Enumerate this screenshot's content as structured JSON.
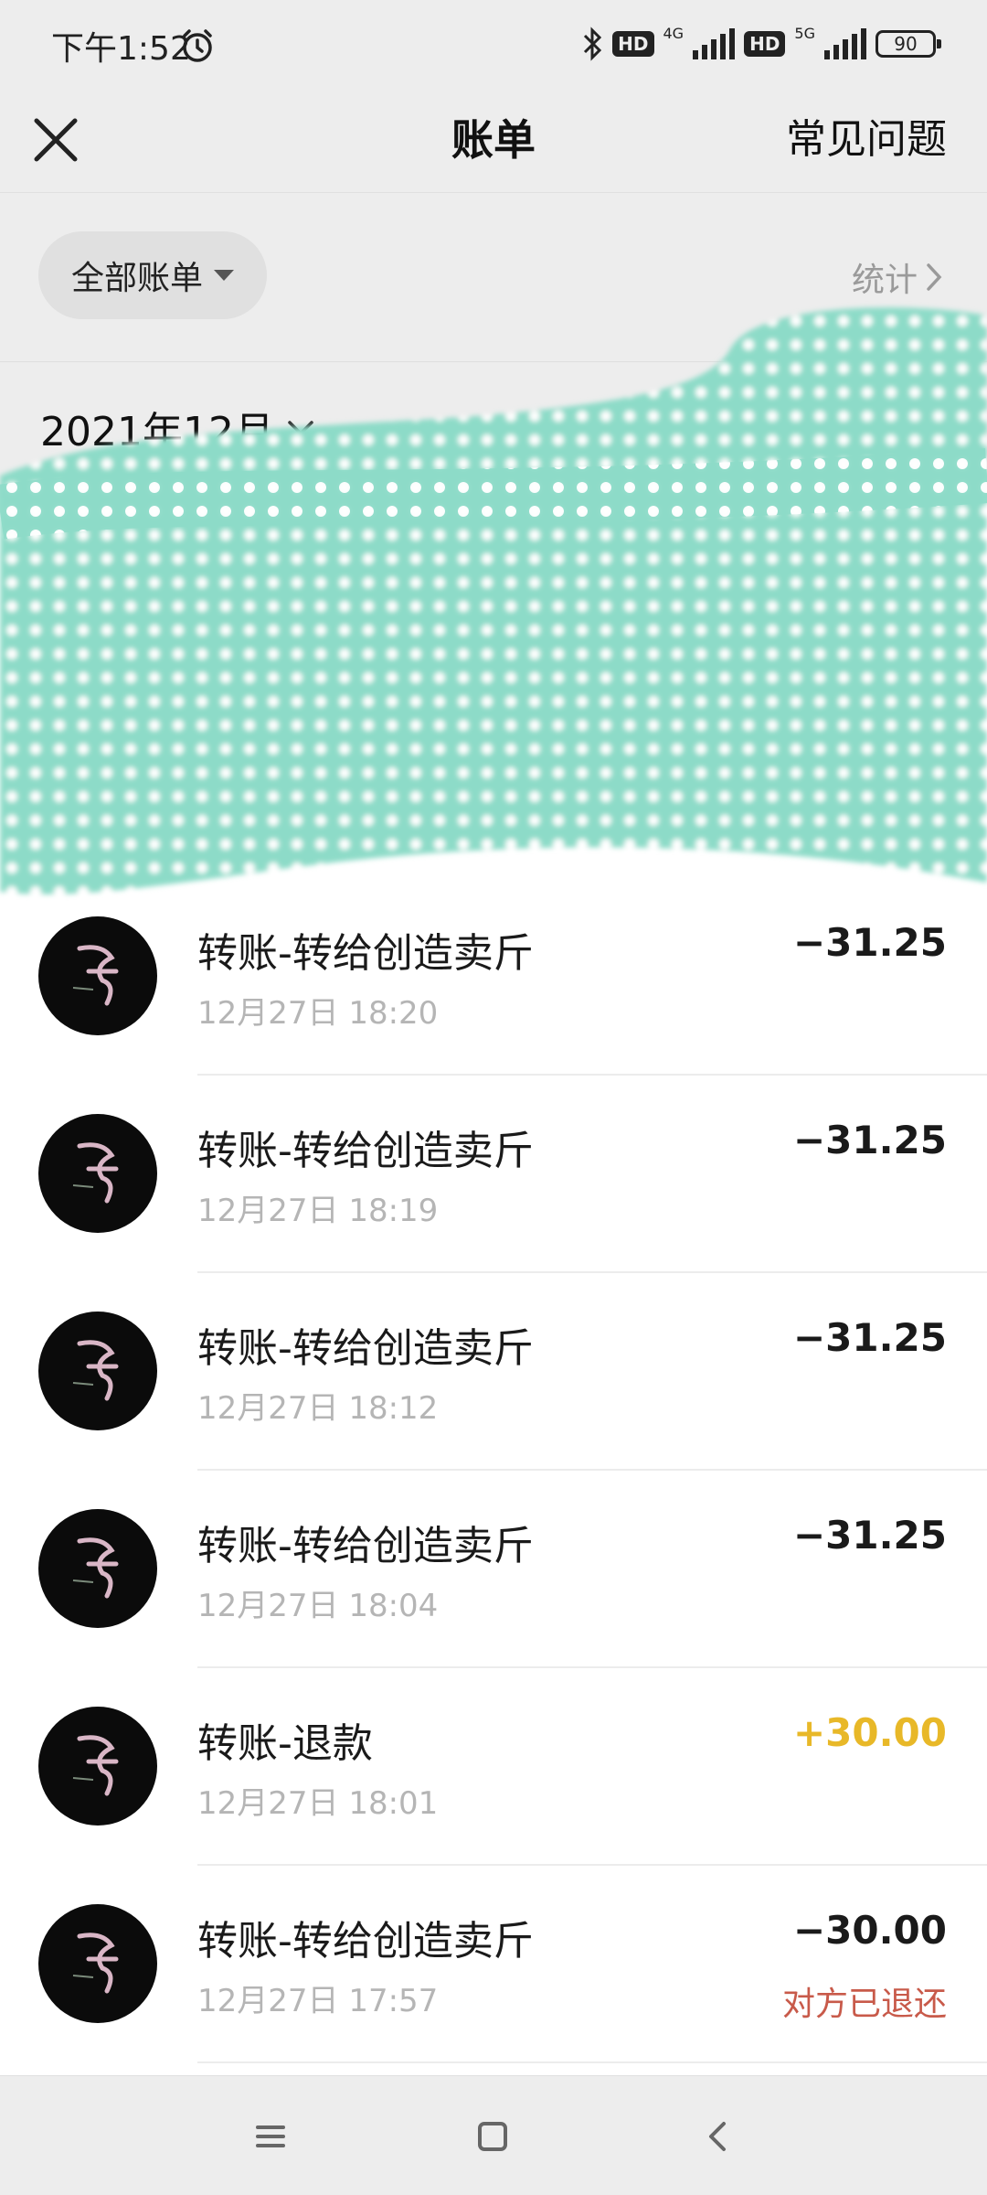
{
  "status_bar": {
    "time": "下午1:52",
    "hd_labels": [
      "HD",
      "HD"
    ],
    "network_labels": [
      "4G",
      "5G"
    ],
    "battery": "90"
  },
  "nav": {
    "title": "账单",
    "faq_label": "常见问题"
  },
  "filter": {
    "label": "全部账单",
    "stats_label": "统计"
  },
  "month": {
    "label": "2021年12月"
  },
  "transactions": [
    {
      "title": "转账-转给创造卖斤",
      "time": "12月27日 18:20",
      "amount": "−31.25",
      "status": ""
    },
    {
      "title": "转账-转给创造卖斤",
      "time": "12月27日 18:19",
      "amount": "−31.25",
      "status": ""
    },
    {
      "title": "转账-转给创造卖斤",
      "time": "12月27日 18:12",
      "amount": "−31.25",
      "status": ""
    },
    {
      "title": "转账-转给创造卖斤",
      "time": "12月27日 18:04",
      "amount": "−31.25",
      "status": ""
    },
    {
      "title": "转账-退款",
      "time": "12月27日 18:01",
      "amount": "+30.00",
      "status": ""
    },
    {
      "title": "转账-转给创造卖斤",
      "time": "12月27日 17:57",
      "amount": "−30.00",
      "status": "对方已退还"
    }
  ],
  "colors": {
    "income": "#e8b828",
    "refund_status": "#c85a4a",
    "redaction": "#8ddbc8"
  },
  "icons": {
    "close": "close-icon",
    "caret": "caret-down-icon",
    "stats_chevron": "chevron-right-icon",
    "month_chevron": "chevron-down-icon",
    "menu": "menu-icon",
    "home": "home-icon",
    "back": "back-icon"
  }
}
